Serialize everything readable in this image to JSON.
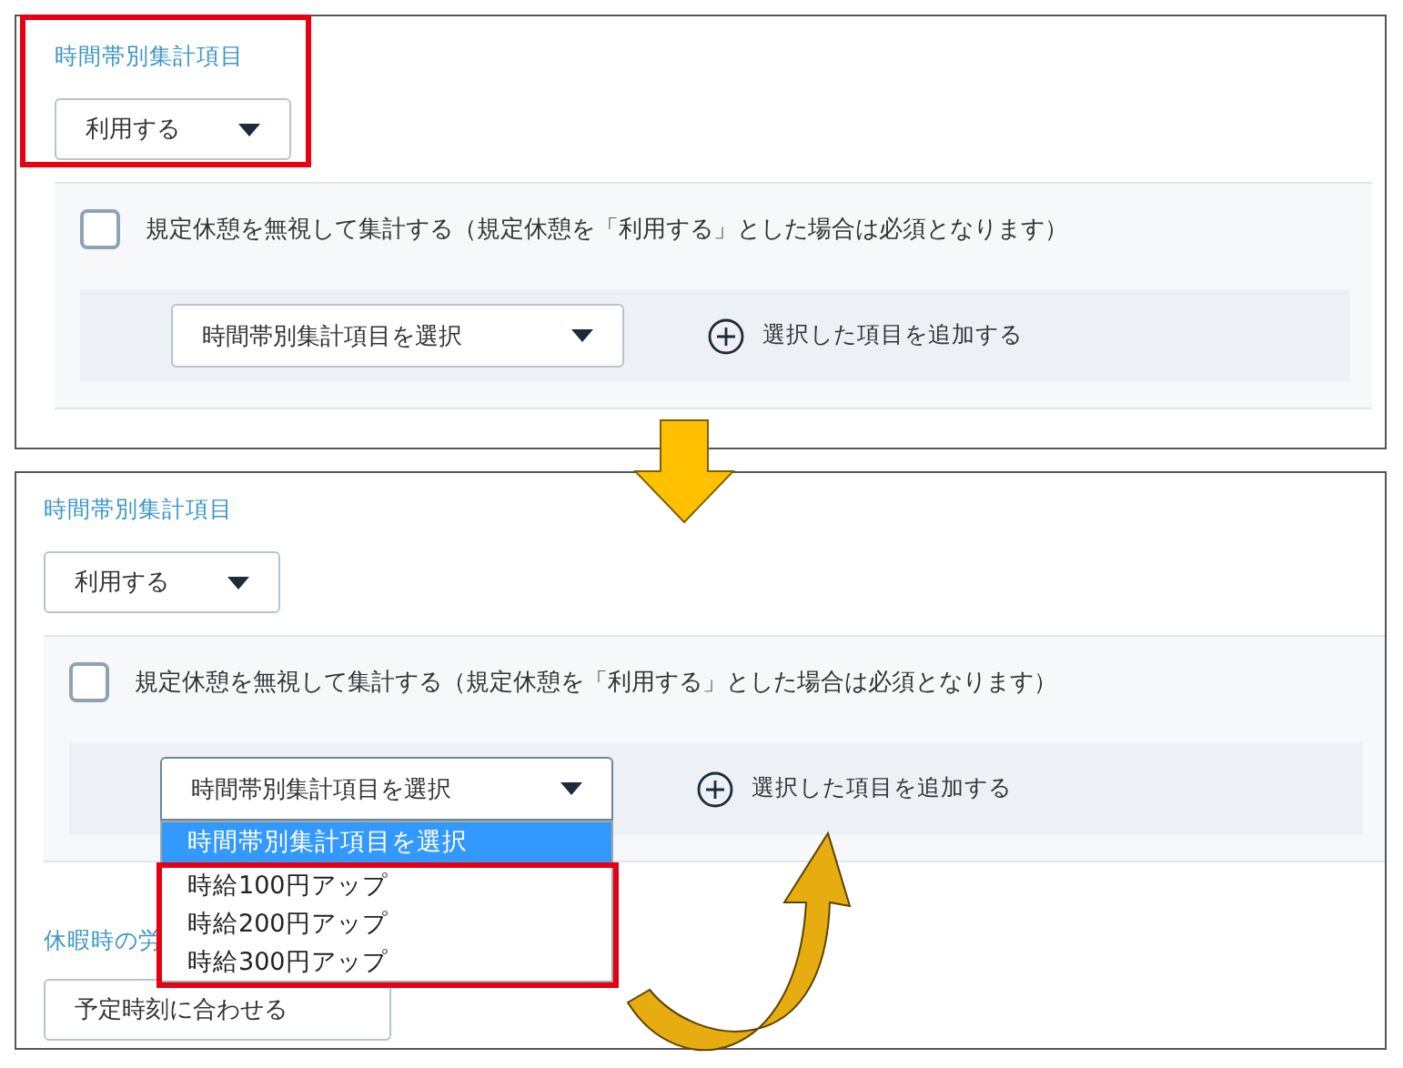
{
  "panels": [
    {
      "section_title": "時間帯別集計項目",
      "mode_select": {
        "value": "利用する",
        "highlighted": true
      },
      "checkbox": {
        "label": "規定休憩を無視して集計する（規定休憩を「利用する」とした場合は必須となります）",
        "checked": false
      },
      "item_select": {
        "value": "時間帯別集計項目を選択",
        "expanded": false
      },
      "add_link": "選択した項目を追加する"
    },
    {
      "section_title": "時間帯別集計項目",
      "mode_select": {
        "value": "利用する"
      },
      "checkbox": {
        "label": "規定休憩を無視して集計する（規定休憩を「利用する」とした場合は必須となります）",
        "checked": false
      },
      "item_select": {
        "value": "時間帯別集計項目を選択",
        "expanded": true,
        "options_highlighted": true,
        "options": [
          {
            "label": "時間帯別集計項目を選択",
            "selected": true
          },
          {
            "label": "時給100円アップ",
            "selected": false
          },
          {
            "label": "時給200円アップ",
            "selected": false
          },
          {
            "label": "時給300円アップ",
            "selected": false
          }
        ]
      },
      "add_link": "選択した項目を追加する",
      "next_section": {
        "title": "休暇時の労",
        "select_value": "予定時刻に合わせる"
      }
    }
  ]
}
